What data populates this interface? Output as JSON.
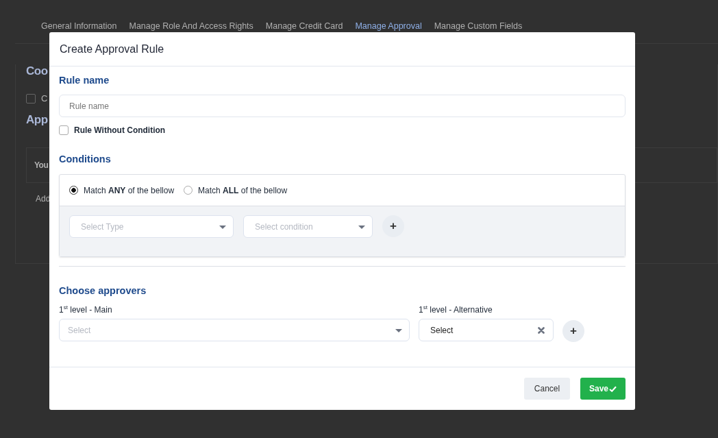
{
  "tabs": [
    {
      "label": "General Information",
      "selected": false
    },
    {
      "label": "Manage Role And Access Rights",
      "selected": false
    },
    {
      "label": "Manage Credit Card",
      "selected": false
    },
    {
      "label": "Manage Approval",
      "selected": true
    },
    {
      "label": "Manage Custom Fields",
      "selected": false
    }
  ],
  "background": {
    "heading_1": "Coo",
    "checkbox": {
      "label": "C",
      "checked": false
    },
    "heading_2": "App",
    "box_title": "You",
    "box_text": "Add"
  },
  "dialog": {
    "title": "Create Approval Rule",
    "rule_name": {
      "heading": "Rule name",
      "placeholder": "Rule name"
    },
    "without_condition": {
      "label": "Rule Without Condition",
      "checked": false
    },
    "conditions": {
      "heading": "Conditions",
      "match_options": [
        {
          "label": "Match **ANY** of the bellow",
          "selected": true
        },
        {
          "label": "Match **ALL** of the bellow",
          "selected": false
        }
      ],
      "type_select": {
        "placeholder": "Select Type"
      },
      "condition_select": {
        "placeholder": "Select condition"
      },
      "add_button": "+"
    },
    "approvers": {
      "heading": "Choose approvers",
      "main": {
        "label": "1$^{st}$ level - Main",
        "placeholder": "Select"
      },
      "alternative": {
        "label": "1$^{st}$ level - Alternative",
        "value": "Select"
      },
      "add_button": "+"
    },
    "buttons": {
      "cancel": "Cancel",
      "save": "Save"
    }
  }
}
